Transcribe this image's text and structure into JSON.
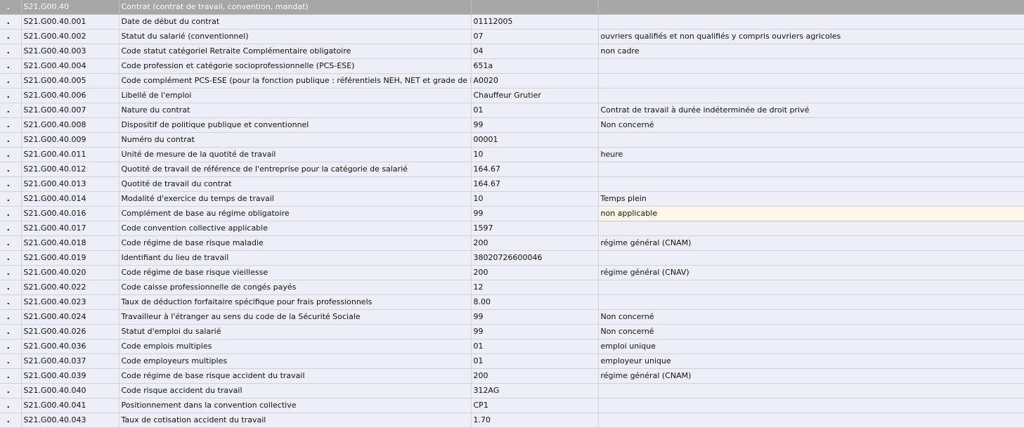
{
  "table": {
    "header": {
      "marker": ".",
      "code": "S21.G00.40",
      "label": "Contrat (contrat de travail, convention, mandat)",
      "value": "",
      "description": ""
    },
    "rows": [
      {
        "marker": ".",
        "code": "S21.G00.40.001",
        "label": "Date de début du contrat",
        "value": "01112005",
        "description": ""
      },
      {
        "marker": ".",
        "code": "S21.G00.40.002",
        "label": "Statut du salarié (conventionnel)",
        "value": "07",
        "description": "ouvriers qualifiés et non qualifiés y compris ouvriers agricoles"
      },
      {
        "marker": ".",
        "code": "S21.G00.40.003",
        "label": "Code statut catégoriel Retraite Complémentaire obligatoire",
        "value": "04",
        "description": "non cadre"
      },
      {
        "marker": ".",
        "code": "S21.G00.40.004",
        "label": "Code profession et catégorie socioprofessionnelle (PCS-ESE)",
        "value": "651a",
        "description": ""
      },
      {
        "marker": ".",
        "code": "S21.G00.40.005",
        "label": "Code complément PCS-ESE (pour la fonction publique : référentiels NEH, NET et grade de la NNE)",
        "value": "A0020",
        "description": ""
      },
      {
        "marker": ".",
        "code": "S21.G00.40.006",
        "label": "Libellé de l'emploi",
        "value": "Chauffeur Grutier",
        "description": ""
      },
      {
        "marker": ".",
        "code": "S21.G00.40.007",
        "label": "Nature du contrat",
        "value": "01",
        "description": "Contrat de travail à durée indéterminée de droit privé"
      },
      {
        "marker": ".",
        "code": "S21.G00.40.008",
        "label": "Dispositif de politique publique et conventionnel",
        "value": "99",
        "description": "Non concerné"
      },
      {
        "marker": ".",
        "code": "S21.G00.40.009",
        "label": "Numéro du contrat",
        "value": "00001",
        "description": ""
      },
      {
        "marker": ".",
        "code": "S21.G00.40.011",
        "label": "Unité de mesure de la quotité de travail",
        "value": "10",
        "description": "heure"
      },
      {
        "marker": ".",
        "code": "S21.G00.40.012",
        "label": "Quotité de travail de référence de l'entreprise pour la catégorie de salarié",
        "value": "164.67",
        "description": ""
      },
      {
        "marker": ".",
        "code": "S21.G00.40.013",
        "label": "Quotité de travail du contrat",
        "value": "164.67",
        "description": ""
      },
      {
        "marker": ".",
        "code": "S21.G00.40.014",
        "label": "Modalité d'exercice du temps de travail",
        "value": "10",
        "description": "Temps plein"
      },
      {
        "marker": ".",
        "code": "S21.G00.40.016",
        "label": "Complément de base au régime obligatoire",
        "value": "99",
        "description": "non applicable",
        "highlight": true
      },
      {
        "marker": ".",
        "code": "S21.G00.40.017",
        "label": "Code convention collective applicable",
        "value": "1597",
        "description": ""
      },
      {
        "marker": ".",
        "code": "S21.G00.40.018",
        "label": "Code régime de base risque maladie",
        "value": "200",
        "description": "régime général (CNAM)"
      },
      {
        "marker": ".",
        "code": "S21.G00.40.019",
        "label": "Identifiant du lieu de travail",
        "value": "38020726600046",
        "description": ""
      },
      {
        "marker": ".",
        "code": "S21.G00.40.020",
        "label": "Code régime de base risque vieillesse",
        "value": "200",
        "description": "régime général (CNAV)"
      },
      {
        "marker": ".",
        "code": "S21.G00.40.022",
        "label": "Code caisse professionnelle de congés payés",
        "value": "12",
        "description": ""
      },
      {
        "marker": ".",
        "code": "S21.G00.40.023",
        "label": "Taux de déduction forfaitaire spécifique pour frais professionnels",
        "value": "8.00",
        "description": ""
      },
      {
        "marker": ".",
        "code": "S21.G00.40.024",
        "label": "Travailleur à l'étranger au sens du code de la Sécurité Sociale",
        "value": "99",
        "description": "Non concerné"
      },
      {
        "marker": ".",
        "code": "S21.G00.40.026",
        "label": "Statut d'emploi du salarié",
        "value": "99",
        "description": "Non concerné"
      },
      {
        "marker": ".",
        "code": "S21.G00.40.036",
        "label": "Code emplois multiples",
        "value": "01",
        "description": "emploi unique"
      },
      {
        "marker": ".",
        "code": "S21.G00.40.037",
        "label": "Code employeurs multiples",
        "value": "01",
        "description": "employeur unique"
      },
      {
        "marker": ".",
        "code": "S21.G00.40.039",
        "label": "Code régime de base risque accident du travail",
        "value": "200",
        "description": "régime général (CNAM)"
      },
      {
        "marker": ".",
        "code": "S21.G00.40.040",
        "label": "Code risque accident du travail",
        "value": "312AG",
        "description": ""
      },
      {
        "marker": ".",
        "code": "S21.G00.40.041",
        "label": "Positionnement dans la convention collective",
        "value": "CP1",
        "description": ""
      },
      {
        "marker": ".",
        "code": "S21.G00.40.043",
        "label": "Taux de cotisation accident du travail",
        "value": "1.70",
        "description": ""
      }
    ]
  },
  "colors": {
    "header_bg": "#a7a7a7",
    "row_bg": "#eeeef6",
    "highlight_bg": "#fdf8ea"
  }
}
